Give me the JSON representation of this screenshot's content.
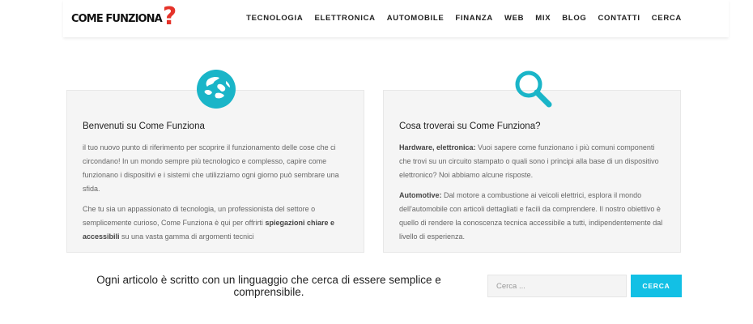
{
  "header": {
    "logo": {
      "text": "COME FUNZIONA",
      "mark": "?"
    },
    "nav": [
      "TECNOLOGIA",
      "ELETTRONICA",
      "AUTOMOBILE",
      "FINANZA",
      "WEB",
      "MIX",
      "BLOG",
      "CONTATTI",
      "CERCA"
    ]
  },
  "cards": {
    "left": {
      "icon": "globe-icon",
      "title": "Benvenuti su Come Funziona",
      "p1": "il tuo nuovo punto di riferimento per scoprire il funzionamento delle cose che ci circondano! In un mondo sempre più tecnologico e complesso, capire come funzionano i dispositivi e i sistemi che utilizziamo ogni giorno può sembrare una sfida.",
      "p2_start": "Che tu sia un appassionato di tecnologia, un professionista del settore o semplicemente curioso, Come Funziona è qui per offrirti ",
      "p2_bold": "spiegazioni chiare e accessibili",
      "p2_end": " su una vasta gamma di argomenti tecnici"
    },
    "right": {
      "icon": "search-icon",
      "title": "Cosa troverai su Come Funziona?",
      "p1_bold": "Hardware, elettronica:",
      "p1": " Vuoi sapere come funzionano i più comuni componenti che trovi su un circuito stampato o quali sono i principi alla base di un dispositivo elettronico? Noi abbiamo alcune risposte.",
      "p2_bold": "Automotive:",
      "p2": " Dal motore a combustione ai veicoli elettrici, esplora il mondo dell'automobile con articoli dettagliati e facili da comprendere. Il nostro obiettivo è quello di rendere la conoscenza tecnica accessibile a tutti, indipendentemente dal livello di esperienza."
    }
  },
  "tagline": "Ogni articolo è scritto con un linguaggio che cerca di essere semplice e comprensibile.",
  "search": {
    "placeholder": "Cerca ...",
    "button": "CERCA"
  },
  "colors": {
    "accent": "#1ab5c8",
    "button": "#12c0e5",
    "logo_mark": "#e5332a"
  }
}
